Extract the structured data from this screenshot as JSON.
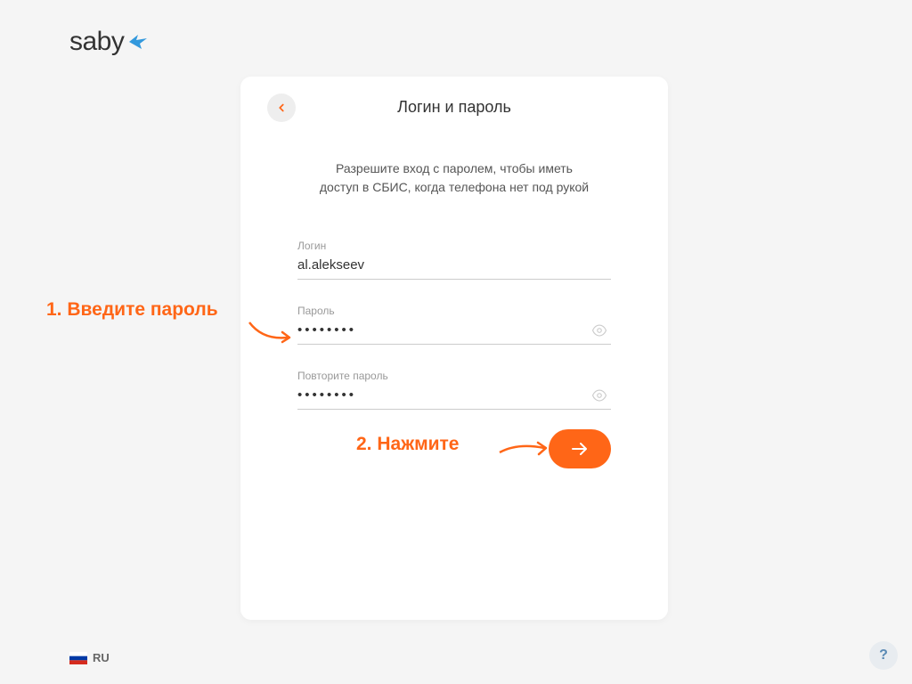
{
  "logo": {
    "text": "saby"
  },
  "card": {
    "title": "Логин и пароль",
    "description_line1": "Разрешите вход с паролем, чтобы иметь",
    "description_line2": "доступ в СБИС, когда телефона нет под рукой"
  },
  "form": {
    "login": {
      "label": "Логин",
      "value": "al.alekseev"
    },
    "password": {
      "label": "Пароль",
      "value": "••••••••"
    },
    "repeat_password": {
      "label": "Повторите пароль",
      "value": "••••••••"
    }
  },
  "annotations": {
    "step1": "1. Введите пароль",
    "step2": "2. Нажмите"
  },
  "footer": {
    "lang_code": "RU",
    "help": "?"
  }
}
